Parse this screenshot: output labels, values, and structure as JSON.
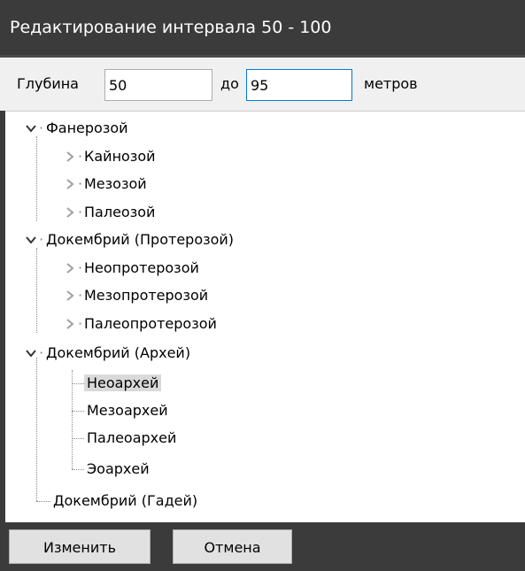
{
  "window": {
    "title": "Редактирование интервала 50 - 100"
  },
  "depth": {
    "label": "Глубина",
    "from_value": "50",
    "to_label": "до",
    "to_value": "95",
    "unit": "метров"
  },
  "tree": {
    "n0": "Фанерозой",
    "n1": "Кайнозой",
    "n2": "Мезозой",
    "n3": "Палеозой",
    "n4": "Докембрий (Протерозой)",
    "n5": "Неопротерозой",
    "n6": "Мезопротерозой",
    "n7": "Палеопротерозой",
    "n8": "Докембрий (Архей)",
    "n9": "Неоархей",
    "n10": "Мезоархей",
    "n11": "Палеоархей",
    "n12": "Эоархей",
    "n13": "Докембрий (Гадей)",
    "selected": "Неоархей"
  },
  "buttons": {
    "apply": "Изменить",
    "cancel": "Отмена"
  },
  "colors": {
    "chrome": "#3b3b3b",
    "focus_border": "#0078d7",
    "selection": "#d9d9d9"
  }
}
